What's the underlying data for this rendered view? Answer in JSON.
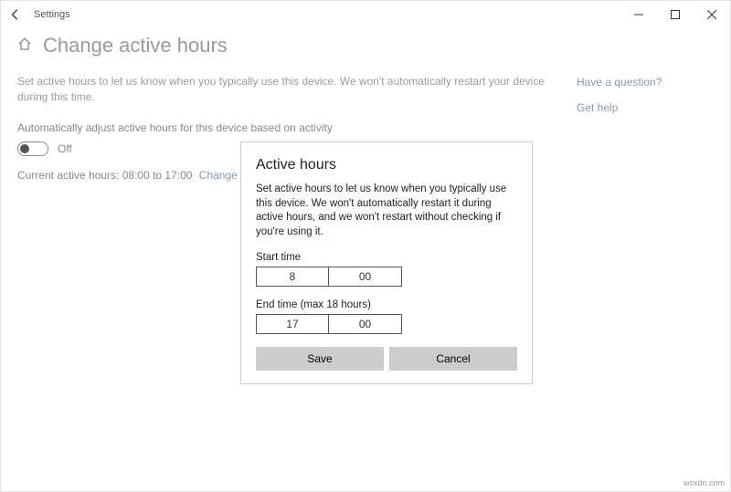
{
  "window": {
    "app_title": "Settings"
  },
  "page": {
    "heading": "Change active hours",
    "description": "Set active hours to let us know when you typically use this device. We won't automatically restart your device during this time.",
    "auto_adjust_label": "Automatically adjust active hours for this device based on activity",
    "toggle_state": "Off",
    "current_hours_prefix": "Current active hours: ",
    "current_hours_value": "08:00 to 17:00",
    "change_link": "Change"
  },
  "sidebar": {
    "question": "Have a question?",
    "get_help": "Get help"
  },
  "dialog": {
    "title": "Active hours",
    "description": "Set active hours to let us know when you typically use this device. We won't automatically restart it during active hours, and we won't restart without checking if you're using it.",
    "start_label": "Start time",
    "start_hour": "8",
    "start_minute": "00",
    "end_label": "End time (max 18 hours)",
    "end_hour": "17",
    "end_minute": "00",
    "save_label": "Save",
    "cancel_label": "Cancel"
  },
  "watermark": "wsxdn.com"
}
